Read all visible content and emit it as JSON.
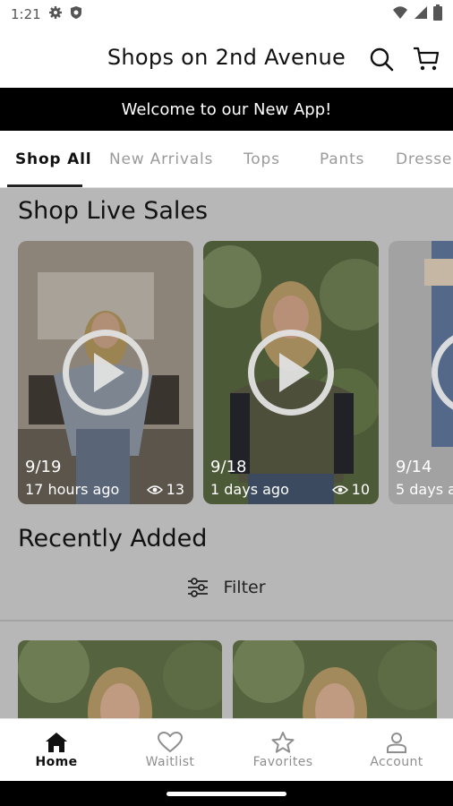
{
  "status_bar": {
    "time": "1:21",
    "left_icons": [
      "gear-icon",
      "shield-icon"
    ],
    "right_icons": [
      "wifi-icon",
      "signal-icon",
      "battery-icon"
    ]
  },
  "header": {
    "title": "Shops on 2nd Avenue",
    "icons": [
      "search-icon",
      "cart-icon"
    ]
  },
  "banner": {
    "text": "Welcome to our New App!"
  },
  "tabs": [
    {
      "label": "Shop All",
      "active": true
    },
    {
      "label": "New Arrivals",
      "active": false
    },
    {
      "label": "Tops",
      "active": false
    },
    {
      "label": "Pants",
      "active": false
    },
    {
      "label": "Dresse",
      "active": false
    }
  ],
  "live_sales": {
    "title": "Shop Live Sales",
    "cards": [
      {
        "date": "9/19",
        "ago": "17 hours ago",
        "views": "13"
      },
      {
        "date": "9/18",
        "ago": "1 days ago",
        "views": "10"
      },
      {
        "date": "9/14",
        "ago": "5 days a",
        "views": ""
      }
    ]
  },
  "recently_added": {
    "title": "Recently Added",
    "filter_label": "Filter"
  },
  "bottom_nav": [
    {
      "label": "Home",
      "icon": "home-icon",
      "active": true
    },
    {
      "label": "Waitlist",
      "icon": "heart-icon",
      "active": false
    },
    {
      "label": "Favorites",
      "icon": "star-icon",
      "active": false
    },
    {
      "label": "Account",
      "icon": "person-icon",
      "active": false
    }
  ],
  "colors": {
    "banner_bg": "#000000",
    "overlay": "#b7b7b7",
    "active_tab": "#111111",
    "inactive_tab": "#9a9a9a"
  }
}
